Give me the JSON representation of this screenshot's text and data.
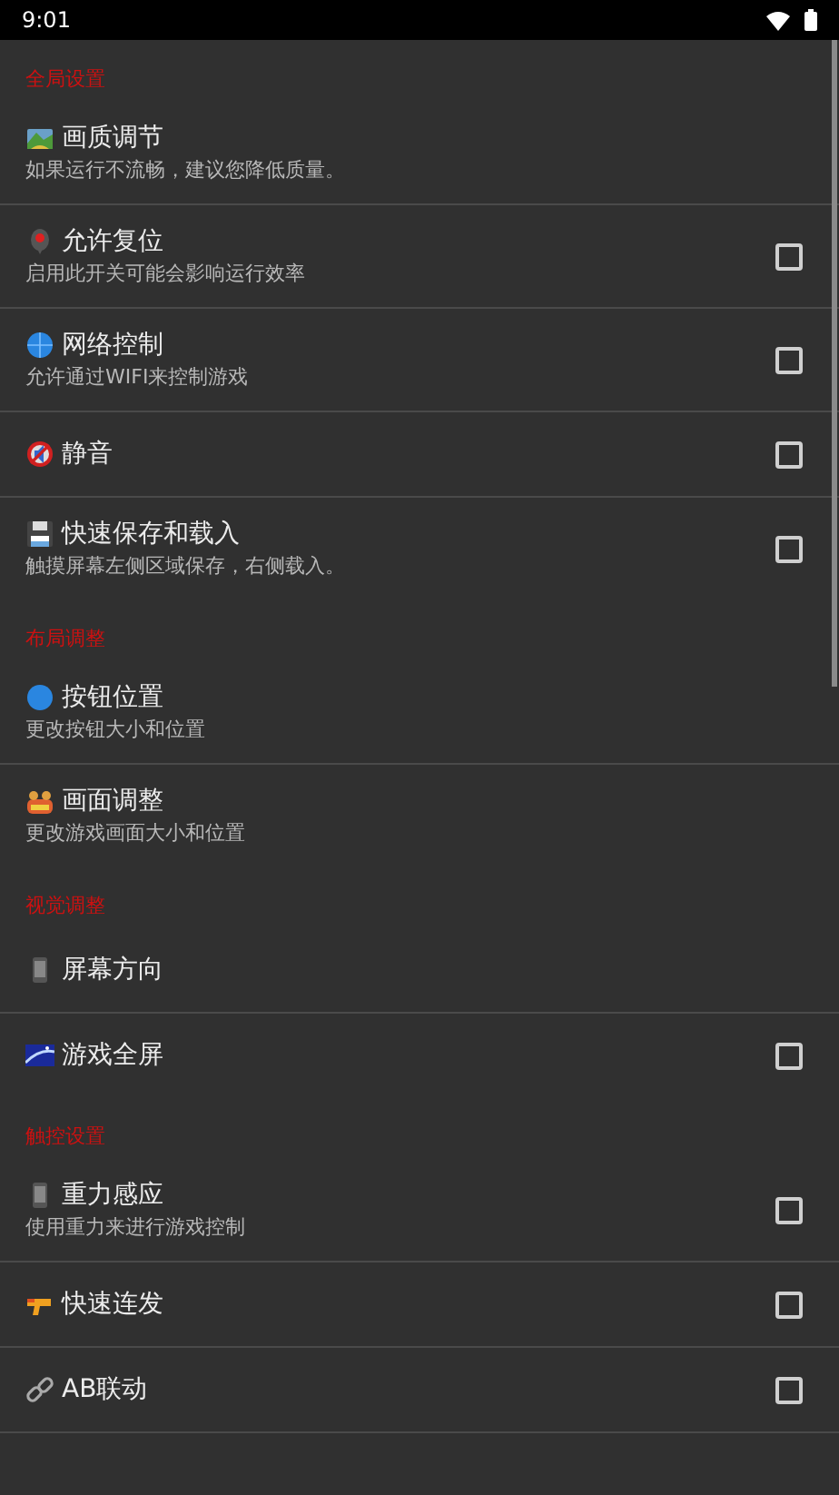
{
  "status_bar": {
    "time": "9:01"
  },
  "sections": [
    {
      "title": "全局设置",
      "items": [
        {
          "kind": "link",
          "title": "画质调节",
          "subtitle": "如果运行不流畅，建议您降低质量。"
        },
        {
          "kind": "checkbox",
          "title": "允许复位",
          "subtitle": "启用此开关可能会影响运行效率",
          "checked": false
        },
        {
          "kind": "checkbox",
          "title": "网络控制",
          "subtitle": "允许通过WIFI来控制游戏",
          "checked": false
        },
        {
          "kind": "checkbox",
          "title": "静音",
          "checked": false
        },
        {
          "kind": "checkbox",
          "title": "快速保存和载入",
          "subtitle": "触摸屏幕左侧区域保存，右侧载入。",
          "checked": false
        }
      ]
    },
    {
      "title": "布局调整",
      "items": [
        {
          "kind": "link",
          "title": "按钮位置",
          "subtitle": "更改按钮大小和位置"
        },
        {
          "kind": "link",
          "title": "画面调整",
          "subtitle": "更改游戏画面大小和位置"
        }
      ]
    },
    {
      "title": "视觉调整",
      "items": [
        {
          "kind": "link",
          "title": "屏幕方向"
        },
        {
          "kind": "checkbox",
          "title": "游戏全屏",
          "checked": false
        }
      ]
    },
    {
      "title": "触控设置",
      "items": [
        {
          "kind": "checkbox",
          "title": "重力感应",
          "subtitle": "使用重力来进行游戏控制",
          "checked": false
        },
        {
          "kind": "checkbox",
          "title": "快速连发",
          "checked": false
        },
        {
          "kind": "checkbox",
          "title": "AB联动",
          "checked": false
        }
      ]
    }
  ]
}
